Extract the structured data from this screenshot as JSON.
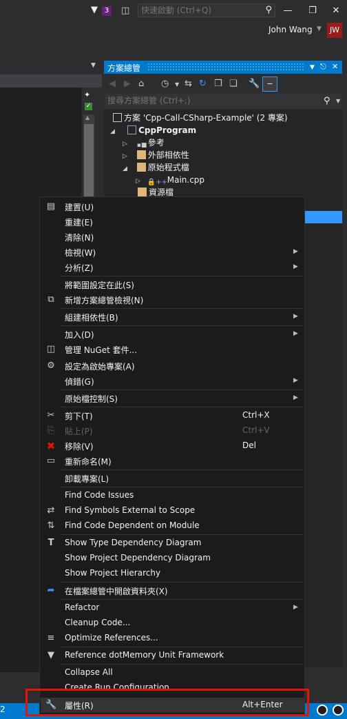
{
  "titlebar": {
    "notification_count": "3",
    "quick_launch_placeholder": "快速啟動 (Ctrl+Q)",
    "user_name": "John Wang",
    "user_initials": "JW"
  },
  "solution_explorer": {
    "title": "方案總管",
    "search_placeholder": "搜尋方案總管 (Ctrl+;)",
    "tree": {
      "solution": "方案 'Cpp-Call-CSharp-Example' (2 專案)",
      "project": "CppProgram",
      "references": "參考",
      "external_deps": "外部相依性",
      "source_files": "原始程式檔",
      "main_cpp": "Main.cpp",
      "resource_files": "資源檔"
    }
  },
  "status": {
    "line_number": "2"
  },
  "context_menu": {
    "build": "建置(U)",
    "rebuild": "重建(E)",
    "clean": "清除(N)",
    "view": "檢視(W)",
    "analyze": "分析(Z)",
    "scope_to_this": "將範圍設定在此(S)",
    "new_se_view": "新增方案總管檢視(N)",
    "build_deps": "組建相依性(B)",
    "add": "加入(D)",
    "manage_nuget": "管理 NuGet 套件...",
    "set_startup": "設定為啟始專案(A)",
    "debug": "偵錯(G)",
    "source_control": "原始檔控制(S)",
    "cut": "剪下(T)",
    "cut_shortcut": "Ctrl+X",
    "paste": "貼上(P)",
    "paste_shortcut": "Ctrl+V",
    "remove": "移除(V)",
    "remove_shortcut": "Del",
    "rename": "重新命名(M)",
    "unload_project": "卸載專案(L)",
    "find_code_issues": "Find Code Issues",
    "find_symbols_external": "Find Symbols External to Scope",
    "find_code_dependent": "Find Code Dependent on Module",
    "show_type_dep": "Show Type Dependency Diagram",
    "show_project_dep": "Show Project Dependency Diagram",
    "show_project_hierarchy": "Show Project Hierarchy",
    "open_in_explorer": "在檔案總管中開啟資料夾(X)",
    "refactor": "Refactor",
    "cleanup_code": "Cleanup Code...",
    "optimize_refs": "Optimize References...",
    "reference_dotmemory": "Reference dotMemory Unit Framework",
    "collapse_all": "Collapse All",
    "create_run_config": "Create Run Configuration...",
    "properties": "屬性(R)",
    "properties_shortcut": "Alt+Enter"
  }
}
